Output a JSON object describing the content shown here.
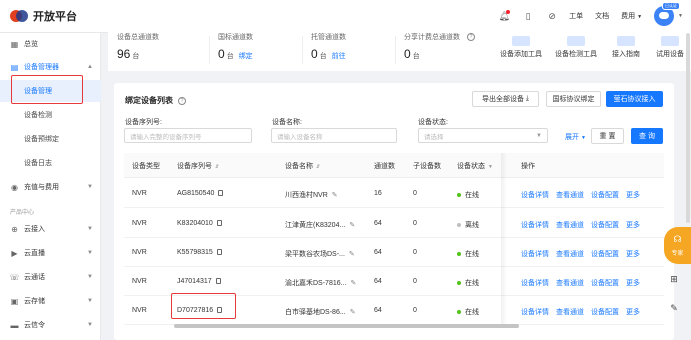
{
  "app": {
    "title": "开放平台"
  },
  "topnav": {
    "links": [
      "工单",
      "文档",
      "费用"
    ],
    "avatar_badge": "已认证"
  },
  "sidebar": {
    "overview": "总览",
    "device_manager": "设备管理器",
    "sub_items": [
      "设备管理",
      "设备检测",
      "设备预绑定",
      "设备日志"
    ],
    "recharge": "充值与费用",
    "section_label": "产品中心",
    "products": [
      "云接入",
      "云直播",
      "云通话",
      "云存储",
      "云信令"
    ]
  },
  "stats": [
    {
      "label": "设备总通道数",
      "value": "96",
      "unit": "台",
      "link": ""
    },
    {
      "label": "国标通道数",
      "value": "0",
      "unit": "台",
      "link": "绑定"
    },
    {
      "label": "托管通道数",
      "value": "0",
      "unit": "台",
      "link": "前往"
    },
    {
      "label": "分享计费总通道数",
      "value": "0",
      "unit": "台",
      "link": ""
    }
  ],
  "tools": [
    "设备添加工具",
    "设备检测工具",
    "接入指南",
    "试用设备"
  ],
  "card": {
    "title": "绑定设备列表",
    "export_btn": "导出全部设备",
    "gb_btn": "国标协议绑定",
    "ys_btn": "萤石协议接入"
  },
  "filters": {
    "serial_label": "设备序列号:",
    "serial_placeholder": "请输入完整的设备序列号",
    "name_label": "设备名称:",
    "name_placeholder": "请输入设备名称",
    "status_label": "设备状态:",
    "status_placeholder": "请选择",
    "expand": "展开",
    "reset": "重 置",
    "query": "查 询"
  },
  "table": {
    "headers": [
      "设备类型",
      "设备序列号",
      "设备名称",
      "通道数",
      "子设备数",
      "设备状态",
      "操作"
    ],
    "ops": [
      "设备详情",
      "查看通道",
      "设备配置",
      "更多"
    ],
    "rows": [
      {
        "type": "NVR",
        "serial": "AG8150540",
        "name": "川西渔村NVR",
        "channels": "16",
        "sub": "0",
        "status": "在线",
        "online": true
      },
      {
        "type": "NVR",
        "serial": "K83204010",
        "name": "江津黄庄(K83204...",
        "channels": "64",
        "sub": "0",
        "status": "离线",
        "online": false
      },
      {
        "type": "NVR",
        "serial": "K55798315",
        "name": "梁平数谷农场DS-...",
        "channels": "64",
        "sub": "0",
        "status": "在线",
        "online": true
      },
      {
        "type": "NVR",
        "serial": "J47014317",
        "name": "渝北嘉禾DS-7816...",
        "channels": "64",
        "sub": "0",
        "status": "在线",
        "online": true
      },
      {
        "type": "NVR",
        "serial": "D70727816",
        "name": "白市驿基地DS-86...",
        "channels": "64",
        "sub": "0",
        "status": "在线",
        "online": true
      }
    ]
  },
  "float": {
    "consult": "专家"
  },
  "colors": {
    "primary": "#1677ff",
    "online": "#52c41a",
    "offline": "#bfbfbf",
    "highlight": "#e5393c"
  }
}
